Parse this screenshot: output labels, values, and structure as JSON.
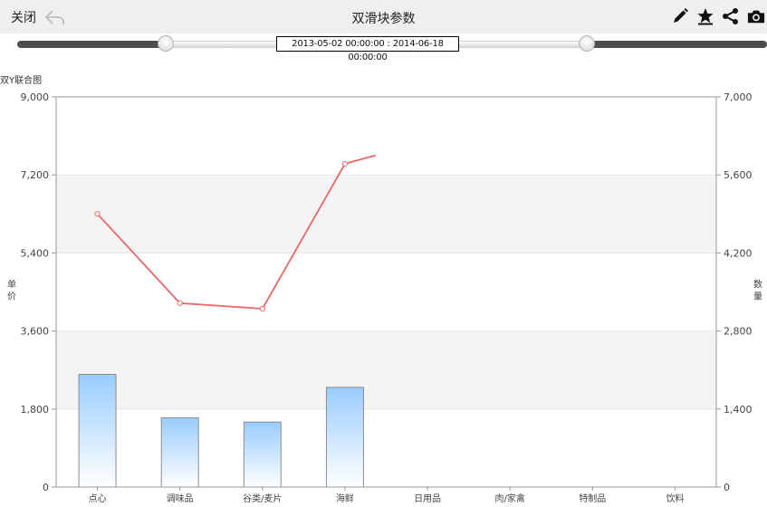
{
  "header": {
    "close_label": "关闭",
    "title": "双滑块参数"
  },
  "icons": {
    "back": "back-arrow-icon",
    "edit": "pencil-icon",
    "favorite": "star-icon",
    "share": "share-icon",
    "snapshot": "camera-icon"
  },
  "slider": {
    "range_label": "2013-05-02 00:00:00 : 2014-06-18 00:00:00"
  },
  "chart_data": {
    "type": "bar+line",
    "title": "双Y联合图",
    "ylabel_left": "单价",
    "ylabel_right": "数量",
    "categories": [
      "点心",
      "调味品",
      "谷类/麦片",
      "海鲜",
      "日用品",
      "肉/家禽",
      "特制品",
      "饮料"
    ],
    "ylim_left": [
      0,
      9000
    ],
    "yticks_left": [
      "0",
      "1,800",
      "3,600",
      "5,400",
      "7,200",
      "9,000"
    ],
    "ylim_right": [
      0,
      7000
    ],
    "yticks_right": [
      "0",
      "1,400",
      "2,800",
      "4,200",
      "5,600",
      "7,000"
    ],
    "series": [
      {
        "type": "bar",
        "axis": "left",
        "values": [
          2600,
          1600,
          1500,
          2300
        ]
      },
      {
        "type": "line",
        "axis": "right",
        "values": [
          4900,
          3300,
          3200,
          5800,
          5950
        ]
      }
    ],
    "colors": {
      "bar": "#99ccff",
      "line": "#e8686a"
    },
    "grid": true
  }
}
